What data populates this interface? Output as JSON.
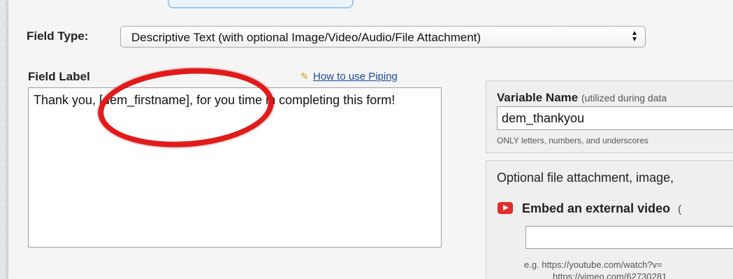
{
  "field_type": {
    "label": "Field Type:",
    "selected": "Descriptive Text (with optional Image/Video/Audio/File Attachment)"
  },
  "field_label": {
    "title": "Field Label",
    "piping_link": "How to use Piping",
    "value": "Thank you, [dem_firstname], for you time in completing this form!"
  },
  "variable": {
    "title": "Variable Name",
    "note": "(utilized during data",
    "value": "dem_thankyou",
    "hint": "ONLY letters, numbers, and underscores"
  },
  "attachment": {
    "title": "Optional file attachment, image,",
    "embed_label": "Embed an external video",
    "embed_paren": "(",
    "example_line1": "e.g. https://youtube.com/watch?v=",
    "example_line2": "https://vimeo.com/62730281"
  },
  "icons": {
    "pencil": "pencil-icon",
    "video": "youtube-play-icon",
    "select_arrows": "updown-arrows-icon"
  },
  "colors": {
    "annotation_circle": "#e11b1b",
    "link": "#1a4a9b",
    "video_icon": "#e52d27"
  }
}
